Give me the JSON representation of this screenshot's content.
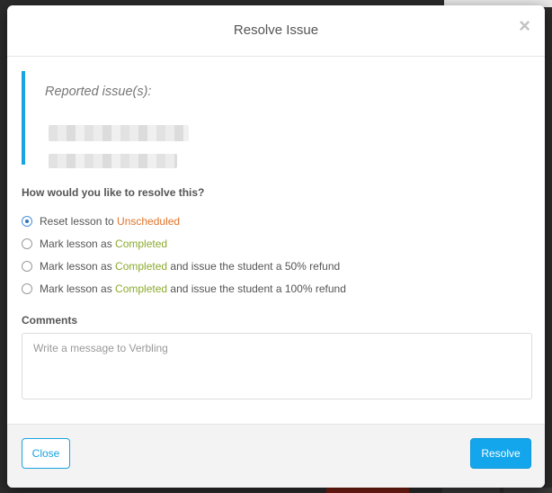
{
  "dialog": {
    "title": "Resolve Issue",
    "close_icon": "×"
  },
  "reported": {
    "label": "Reported issue(s):"
  },
  "resolution": {
    "question": "How would you like to resolve this?",
    "selected_index": 0,
    "options": [
      {
        "prefix": "Reset lesson to ",
        "status": "Unscheduled",
        "status_color": "#e0742b",
        "suffix": ""
      },
      {
        "prefix": "Mark lesson as ",
        "status": "Completed",
        "status_color": "#8aaa2d",
        "suffix": ""
      },
      {
        "prefix": "Mark lesson as ",
        "status": "Completed",
        "status_color": "#8aaa2d",
        "suffix": " and issue the student a 50% refund"
      },
      {
        "prefix": "Mark lesson as ",
        "status": "Completed",
        "status_color": "#8aaa2d",
        "suffix": " and issue the student a 100% refund"
      }
    ]
  },
  "comments": {
    "label": "Comments",
    "value": "",
    "placeholder": "Write a message to Verbling"
  },
  "footer": {
    "close_label": "Close",
    "resolve_label": "Resolve"
  },
  "colors": {
    "accent": "#1aa3e0",
    "unscheduled": "#e0742b",
    "completed": "#8aaa2d"
  }
}
